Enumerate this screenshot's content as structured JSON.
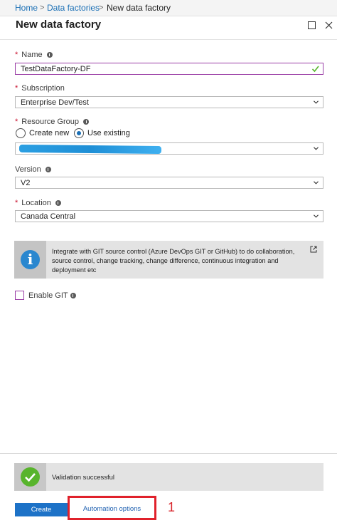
{
  "breadcrumb": {
    "items": [
      "Home",
      "Data factories",
      "New data factory"
    ],
    "separator": ">"
  },
  "blade": {
    "title": "New data factory"
  },
  "form": {
    "required_marker": "*",
    "name": {
      "label": "Name",
      "value": "TestDataFactory-DF"
    },
    "subscription": {
      "label": "Subscription",
      "value": "Enterprise Dev/Test"
    },
    "resource_group": {
      "label": "Resource Group",
      "option_create": "Create new",
      "option_existing": "Use existing",
      "selected": "Use existing"
    },
    "version": {
      "label": "Version",
      "value": "V2"
    },
    "location": {
      "label": "Location",
      "value": "Canada Central"
    },
    "git_info": "Integrate with GIT source control (Azure DevOps GIT or GitHub) to do collaboration, source control, change tracking, change difference, continuous integration and deployment etc",
    "enable_git": {
      "label": "Enable GIT",
      "checked": false
    }
  },
  "footer": {
    "validation": "Validation successful",
    "create_label": "Create",
    "automation_label": "Automation options",
    "annotation": "1"
  },
  "colors": {
    "accent": "#1d72c7",
    "link": "#1a6fb5",
    "required": "#c8102e",
    "valid_green": "#58b42c",
    "highlight_red": "#e0212b",
    "focus_purple": "#9b3ea6"
  }
}
